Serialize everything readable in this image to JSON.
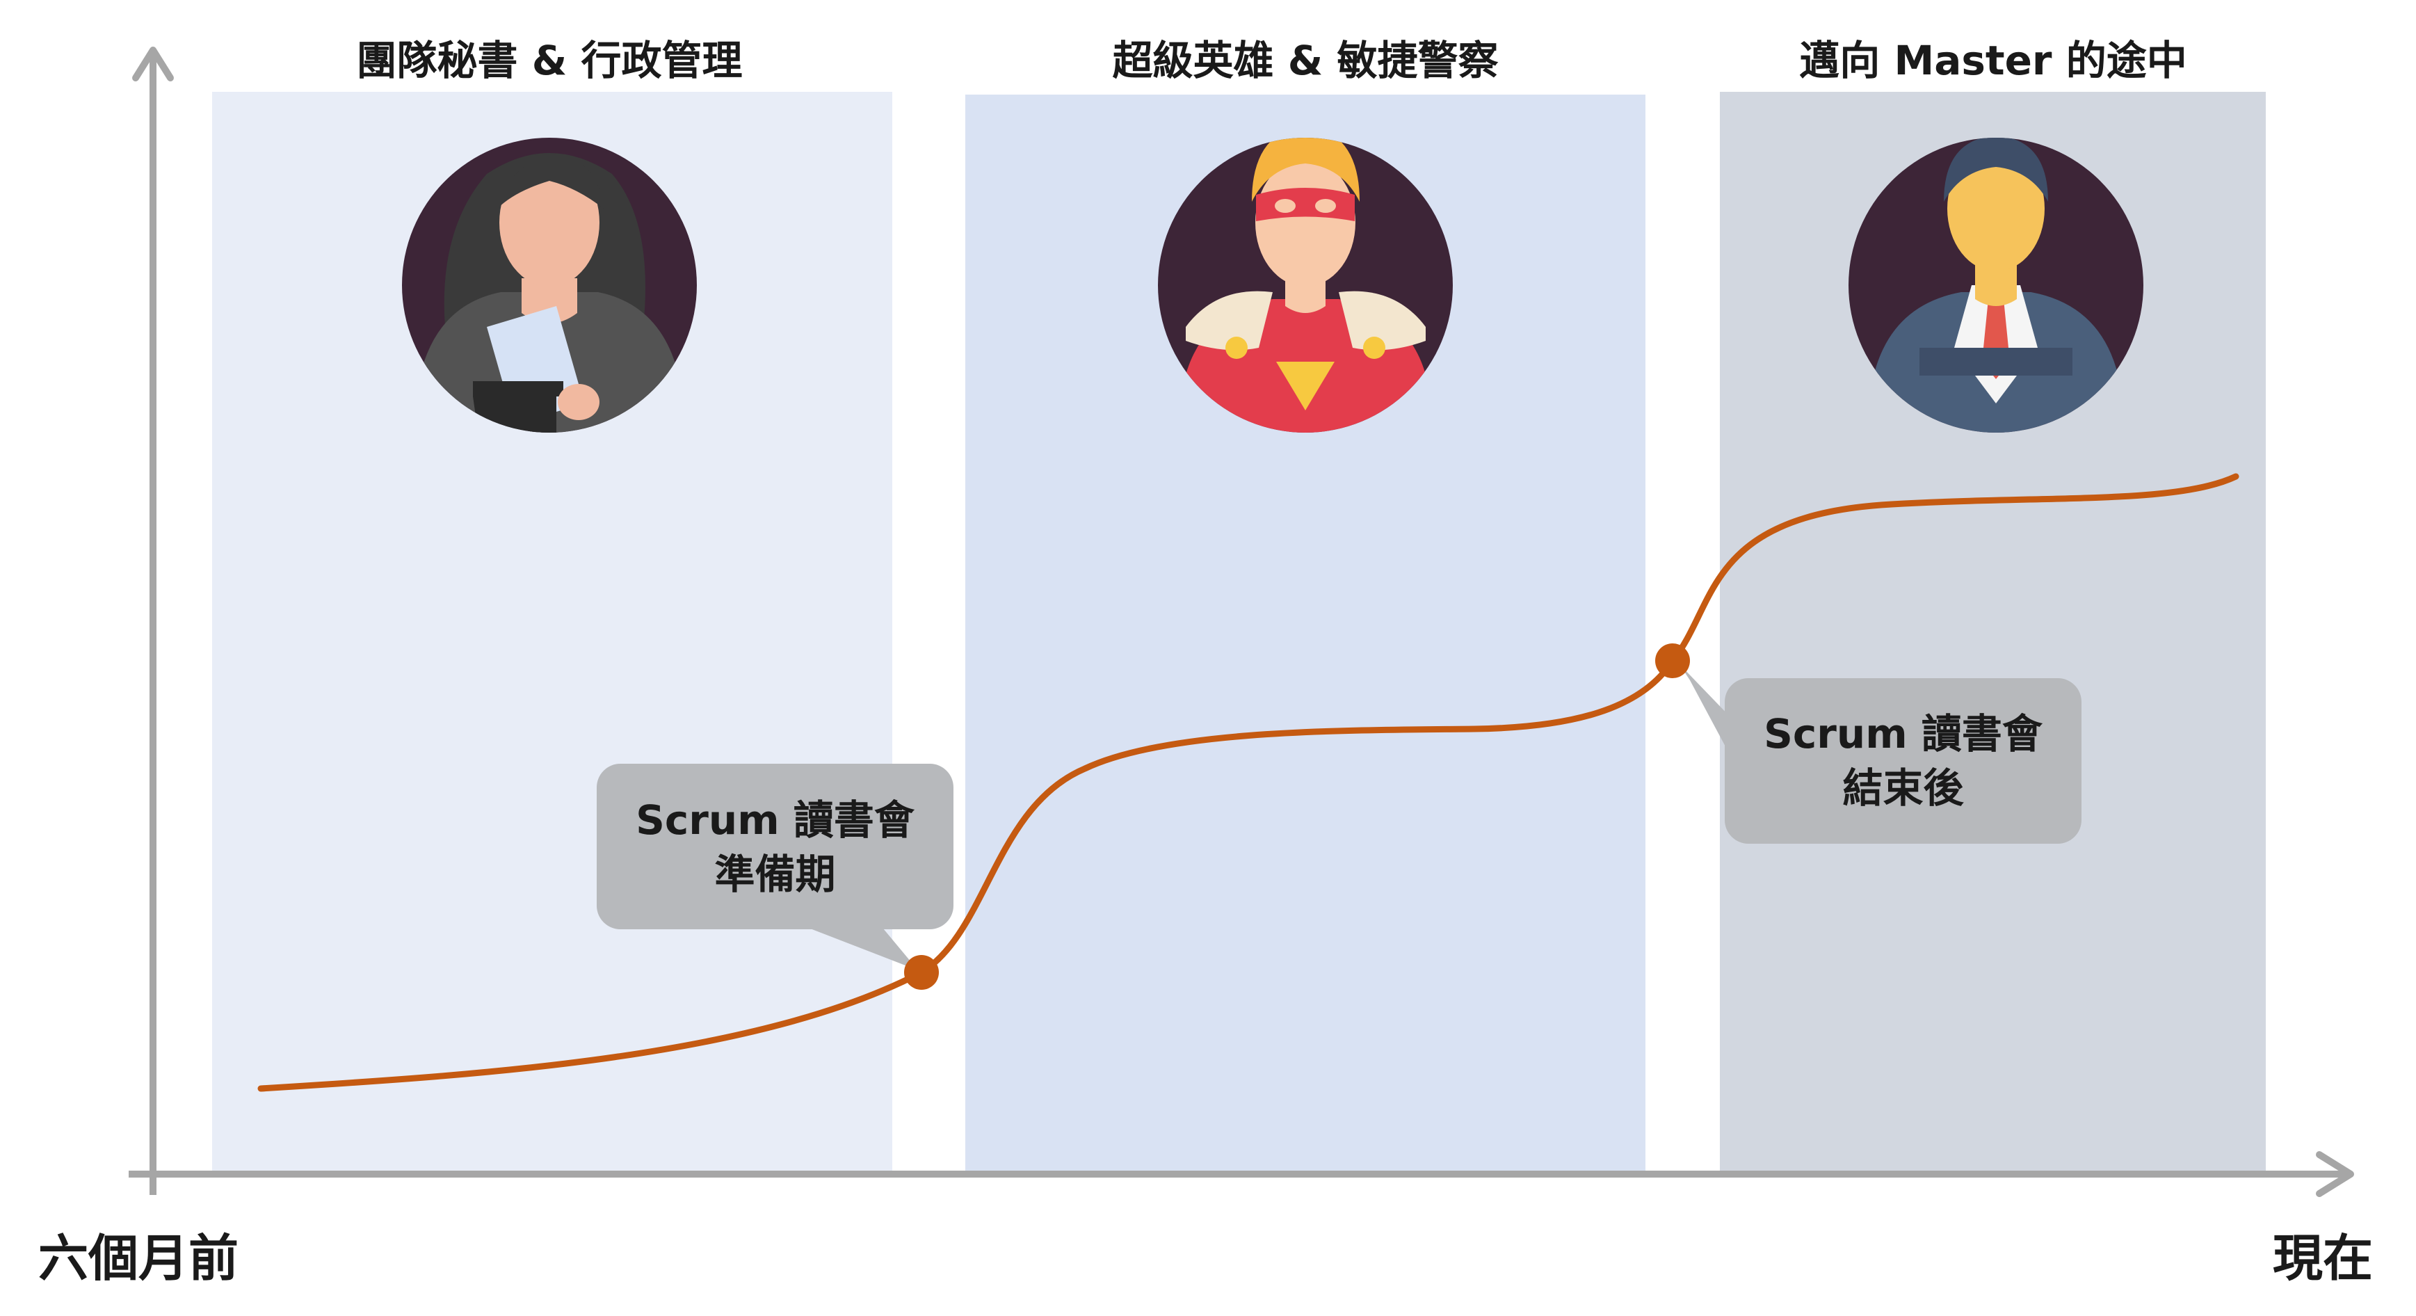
{
  "phases": [
    {
      "title": "團隊秘書 & 行政管理",
      "avatar": "secretary-avatar",
      "band_color": "#E8EDF7"
    },
    {
      "title": "超級英雄 & 敏捷警察",
      "avatar": "superhero-avatar",
      "band_color": "#D9E2F3"
    },
    {
      "title": "邁向 Master 的途中",
      "avatar": "businessman-avatar",
      "band_color": "#D2D7E0"
    }
  ],
  "axis": {
    "start_label": "六個月前",
    "end_label": "現在",
    "color": "#A6A6A6"
  },
  "milestones": [
    {
      "line1": "Scrum 讀書會",
      "line2": "準備期"
    },
    {
      "line1": "Scrum 讀書會",
      "line2": "結束後"
    }
  ],
  "colors": {
    "curve": "#C55A11",
    "callout": "#B7B9BC",
    "avatar_bg": "#3D2537"
  }
}
